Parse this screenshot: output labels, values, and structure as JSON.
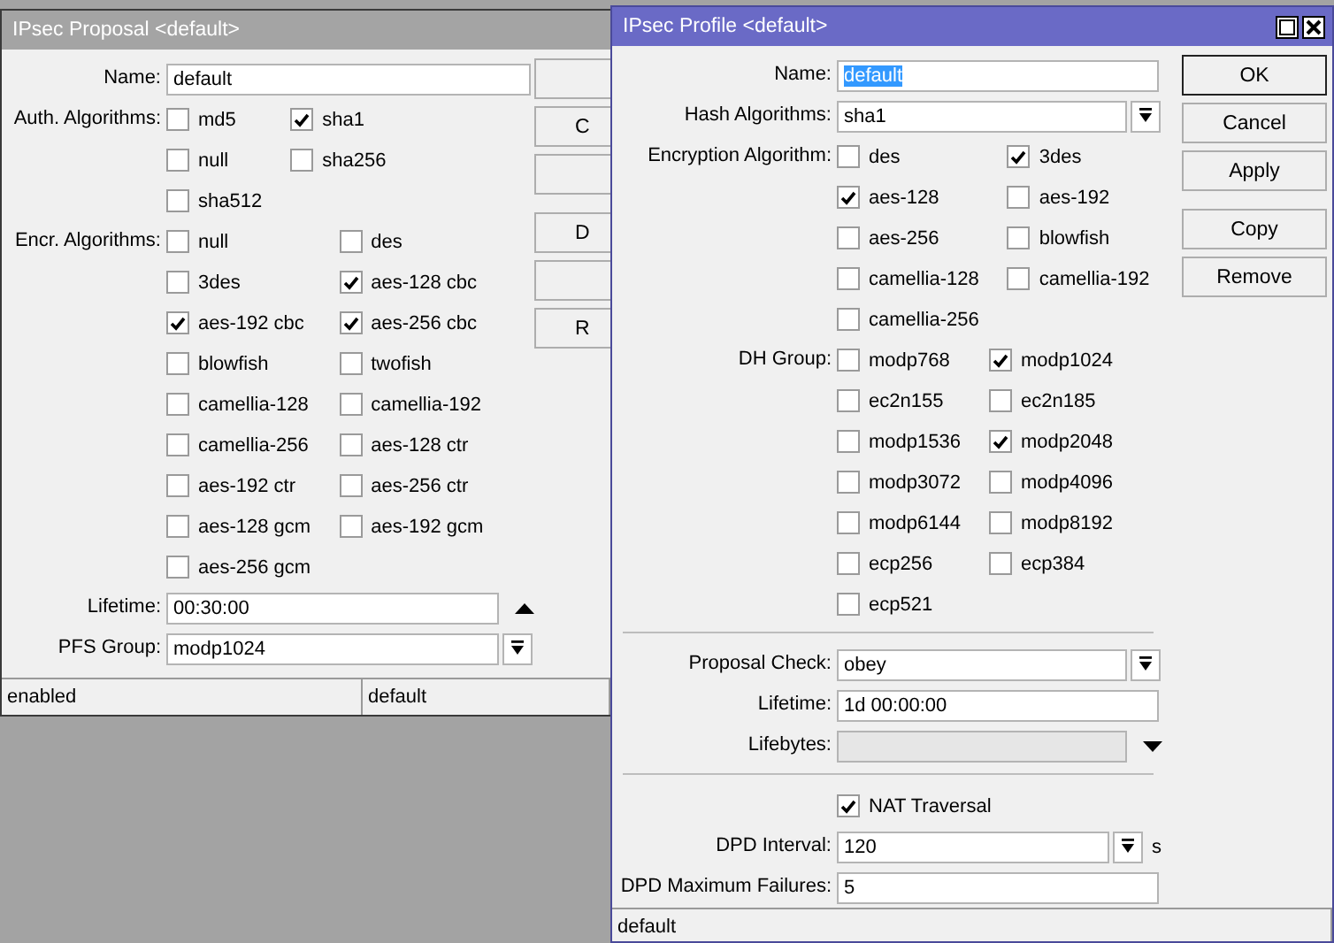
{
  "proposal_window": {
    "title": "IPsec Proposal <default>",
    "fields": [
      {
        "kind": "text",
        "label": "Name:",
        "value": "default",
        "disabled": false
      },
      {
        "kind": "checks",
        "label": "Auth. Algorithms:",
        "options": [
          {
            "label": "md5",
            "checked": false
          },
          {
            "label": "sha1",
            "checked": true
          },
          {
            "label": "null",
            "checked": false
          },
          {
            "label": "sha256",
            "checked": false
          },
          {
            "label": "sha512",
            "checked": false
          }
        ]
      },
      {
        "kind": "checks",
        "label": "Encr. Algorithms:",
        "options": [
          {
            "label": "null",
            "checked": false
          },
          {
            "label": "des",
            "checked": false
          },
          {
            "label": "3des",
            "checked": false
          },
          {
            "label": "aes-128 cbc",
            "checked": true
          },
          {
            "label": "aes-192 cbc",
            "checked": true
          },
          {
            "label": "aes-256 cbc",
            "checked": true
          },
          {
            "label": "blowfish",
            "checked": false
          },
          {
            "label": "twofish",
            "checked": false
          },
          {
            "label": "camellia-128",
            "checked": false
          },
          {
            "label": "camellia-192",
            "checked": false
          },
          {
            "label": "camellia-256",
            "checked": false
          },
          {
            "label": "aes-128 ctr",
            "checked": false
          },
          {
            "label": "aes-192 ctr",
            "checked": false
          },
          {
            "label": "aes-256 ctr",
            "checked": false
          },
          {
            "label": "aes-128 gcm",
            "checked": false
          },
          {
            "label": "aes-192 gcm",
            "checked": false
          },
          {
            "label": "aes-256 gcm",
            "checked": false
          }
        ]
      },
      {
        "kind": "toggle_text",
        "label": "Lifetime:",
        "value": "00:30:00",
        "disabled": false,
        "expanded": true
      },
      {
        "kind": "select",
        "label": "PFS Group:",
        "value": "modp1024"
      }
    ],
    "buttons": [
      {
        "kind": "blank"
      },
      {
        "kind": "labeled",
        "label": "C"
      },
      {
        "kind": "blank"
      },
      {
        "kind": "labeled",
        "label": "D"
      },
      {
        "kind": "blank"
      },
      {
        "kind": "labeled",
        "label": "R"
      }
    ],
    "status_bar": [
      "enabled",
      "default"
    ]
  },
  "profile_window": {
    "title": "IPsec Profile <default>",
    "fields": [
      {
        "kind": "text",
        "label": "Name:",
        "value": "default",
        "disabled": false,
        "text_selected": true
      },
      {
        "kind": "select",
        "label": "Hash Algorithms:",
        "value": "sha1"
      },
      {
        "kind": "checks",
        "label": "Encryption Algorithm:",
        "options": [
          {
            "label": "des",
            "checked": false
          },
          {
            "label": "3des",
            "checked": true
          },
          {
            "label": "aes-128",
            "checked": true
          },
          {
            "label": "aes-192",
            "checked": false
          },
          {
            "label": "aes-256",
            "checked": false
          },
          {
            "label": "blowfish",
            "checked": false
          },
          {
            "label": "camellia-128",
            "checked": false
          },
          {
            "label": "camellia-192",
            "checked": false
          },
          {
            "label": "camellia-256",
            "checked": false
          }
        ]
      },
      {
        "kind": "checks",
        "label": "DH Group:",
        "options": [
          {
            "label": "modp768",
            "checked": false
          },
          {
            "label": "modp1024",
            "checked": true
          },
          {
            "label": "ec2n155",
            "checked": false
          },
          {
            "label": "ec2n185",
            "checked": false
          },
          {
            "label": "modp1536",
            "checked": false
          },
          {
            "label": "modp2048",
            "checked": true
          },
          {
            "label": "modp3072",
            "checked": false
          },
          {
            "label": "modp4096",
            "checked": false
          },
          {
            "label": "modp6144",
            "checked": false
          },
          {
            "label": "modp8192",
            "checked": false
          },
          {
            "label": "ecp256",
            "checked": false
          },
          {
            "label": "ecp384",
            "checked": false
          },
          {
            "label": "ecp521",
            "checked": false
          }
        ]
      },
      {
        "kind": "divider"
      },
      {
        "kind": "select",
        "label": "Proposal Check:",
        "value": "obey"
      },
      {
        "kind": "text",
        "label": "Lifetime:",
        "value": "1d 00:00:00",
        "disabled": false
      },
      {
        "kind": "toggle_text",
        "label": "Lifebytes:",
        "disabled": true,
        "expanded": false
      },
      {
        "kind": "divider"
      },
      {
        "kind": "checkbox",
        "label": "NAT Traversal",
        "checked": true
      },
      {
        "kind": "select",
        "label": "DPD Interval:",
        "value": "120",
        "unit": "s"
      },
      {
        "kind": "text",
        "label": "DPD Maximum Failures:",
        "value": "5",
        "disabled": false
      }
    ],
    "buttons": [
      {
        "kind": "labeled",
        "label": "OK",
        "default": true
      },
      {
        "kind": "labeled",
        "label": "Cancel",
        "default": false
      },
      {
        "kind": "labeled",
        "label": "Apply",
        "default": false
      },
      {
        "kind": "labeled",
        "label": "Copy",
        "default": false
      },
      {
        "kind": "labeled",
        "label": "Remove",
        "default": false
      }
    ],
    "status_bar": [
      "default"
    ]
  }
}
